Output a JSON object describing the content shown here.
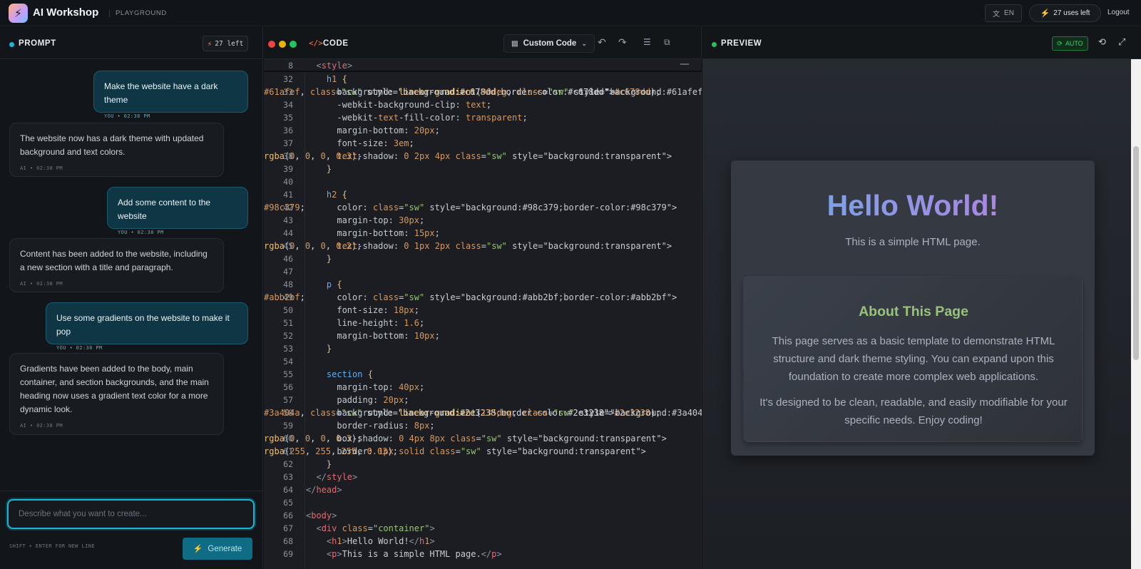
{
  "app": {
    "title": "AI Workshop",
    "tagline": "PLAYGROUND",
    "lang": "EN",
    "uses": "27 uses left",
    "logout": "Logout"
  },
  "prompt_panel": {
    "label": "PROMPT",
    "badge": "27 left",
    "messages": [
      {
        "role": "user",
        "text": "Make the website have a dark theme",
        "meta": "YOU • 02:38 PM"
      },
      {
        "role": "ai",
        "text": "The website now has a dark theme with updated background and text colors.",
        "meta": "AI • 02:38 PM"
      },
      {
        "role": "user",
        "text": "Add some content to the website",
        "meta": "YOU • 02:38 PM"
      },
      {
        "role": "ai",
        "text": "Content has been added to the website, including a new section with a title and paragraph.",
        "meta": "AI • 02:38 PM"
      },
      {
        "role": "user",
        "text": "Use some gradients on the website to make it pop",
        "meta": "YOU • 02:38 PM"
      },
      {
        "role": "ai",
        "text": "Gradients have been added to the body, main container, and section backgrounds, and the main heading now uses a gradient text color for a more dynamic look.",
        "meta": "AI • 02:38 PM"
      }
    ],
    "input_placeholder": "Describe what you want to create...",
    "hint": "SHIFT + ENTER FOR NEW LINE",
    "generate_label": "Generate"
  },
  "code_panel": {
    "label": "CODE",
    "mode": "Custom Code",
    "icons": [
      "undo-icon",
      "redo-icon",
      "format-icon",
      "copy-icon"
    ],
    "sticky": {
      "num": "8",
      "text": "  <style>"
    },
    "lines": [
      {
        "num": "32",
        "text": "    h1 {"
      },
      {
        "num": "33",
        "text": "      background: linear-gradient(90deg, ▪#61afef, ▪#c678dd);"
      },
      {
        "num": "34",
        "text": "      -webkit-background-clip: text;"
      },
      {
        "num": "35",
        "text": "      -webkit-text-fill-color: transparent;"
      },
      {
        "num": "36",
        "text": "      margin-bottom: 20px;"
      },
      {
        "num": "37",
        "text": "      font-size: 3em;"
      },
      {
        "num": "38",
        "text": "      text-shadow: 0 2px 4px ▫rgba(0, 0, 0, 0.3);"
      },
      {
        "num": "39",
        "text": "    }"
      },
      {
        "num": "40",
        "text": ""
      },
      {
        "num": "41",
        "text": "    h2 {"
      },
      {
        "num": "42",
        "text": "      color: ▪#98c379;"
      },
      {
        "num": "43",
        "text": "      margin-top: 30px;"
      },
      {
        "num": "44",
        "text": "      margin-bottom: 15px;"
      },
      {
        "num": "45",
        "text": "      text-shadow: 0 1px 2px ▫rgba(0, 0, 0, 0.2);"
      },
      {
        "num": "46",
        "text": "    }"
      },
      {
        "num": "47",
        "text": ""
      },
      {
        "num": "48",
        "text": "    p {"
      },
      {
        "num": "49",
        "text": "      color: ▪#abb2bf;"
      },
      {
        "num": "50",
        "text": "      font-size: 18px;"
      },
      {
        "num": "51",
        "text": "      line-height: 1.6;"
      },
      {
        "num": "52",
        "text": "      margin-bottom: 10px;"
      },
      {
        "num": "53",
        "text": "    }"
      },
      {
        "num": "54",
        "text": ""
      },
      {
        "num": "55",
        "text": "    section {"
      },
      {
        "num": "56",
        "text": "      margin-top: 40px;"
      },
      {
        "num": "57",
        "text": "      padding: 20px;"
      },
      {
        "num": "58",
        "text": "      background: linear-gradient(135deg, ▪#3a404a, ▪#2e3238);"
      },
      {
        "num": "59",
        "text": "      border-radius: 8px;"
      },
      {
        "num": "60",
        "text": "      box-shadow: 0 4px 8px ▫rgba(0, 0, 0, 0.3);"
      },
      {
        "num": "61",
        "text": "      border: 1px solid ▫rgba(255, 255, 255, 0.03);"
      },
      {
        "num": "62",
        "text": "    }"
      },
      {
        "num": "63",
        "text": "  </style>"
      },
      {
        "num": "64",
        "text": "</head>"
      },
      {
        "num": "65",
        "text": ""
      },
      {
        "num": "66",
        "text": "<body>"
      },
      {
        "num": "67",
        "text": "  <div class=\"container\">"
      },
      {
        "num": "68",
        "text": "    <h1>Hello World!</h1>"
      },
      {
        "num": "69",
        "text": "    <p>This is a simple HTML page.</p>"
      }
    ]
  },
  "preview_panel": {
    "label": "PREVIEW",
    "auto_label": "AUTO",
    "h1": "Hello World!",
    "subtitle": "This is a simple HTML page.",
    "section_title": "About This Page",
    "para1": "This page serves as a basic template to demonstrate HTML structure and dark theme styling. You can expand upon this foundation to create more complex web applications.",
    "para2": "It's designed to be clean, readable, and easily modifiable for your specific needs. Enjoy coding!"
  },
  "colors": {
    "accent": "#1bb6d4",
    "brand_orange": "#ff7a45",
    "preview_green": "#22c55e",
    "h1_grad": [
      "#61afef",
      "#c678dd"
    ],
    "h2": "#98c379",
    "p": "#abb2bf"
  }
}
